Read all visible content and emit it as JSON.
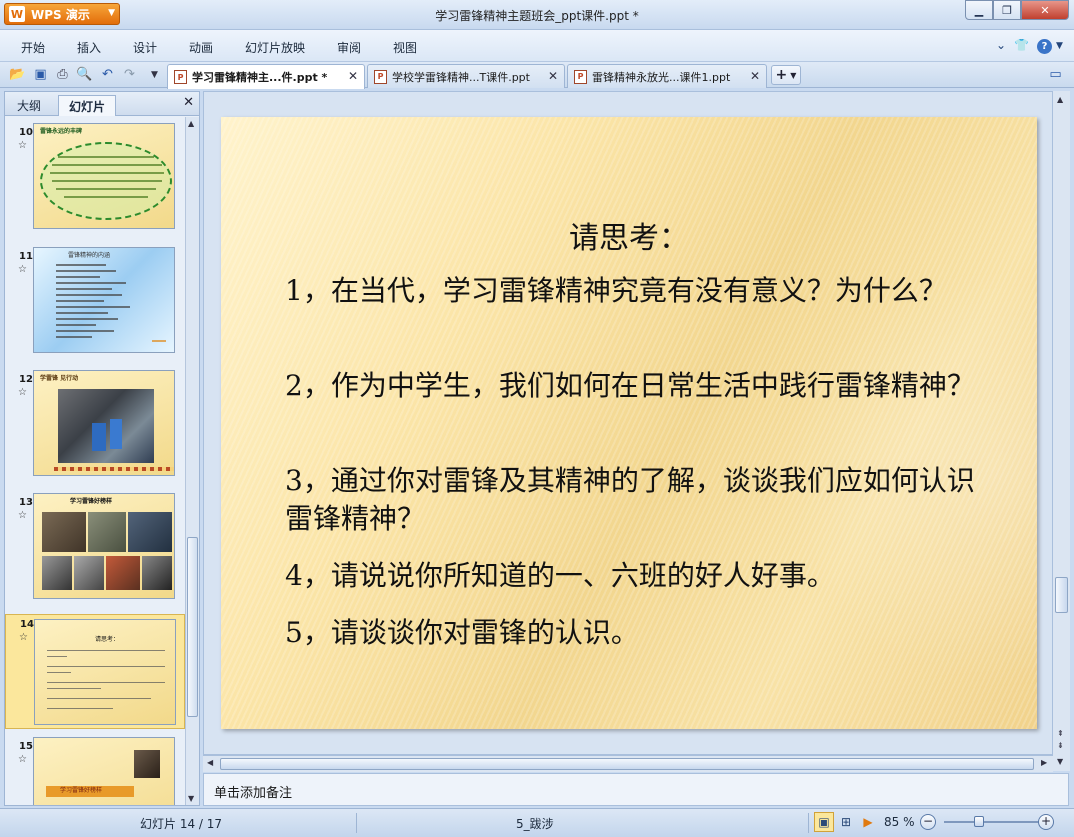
{
  "window": {
    "app_button": "WPS 演示",
    "title": "学习雷锋精神主题班会_ppt课件.ppt *",
    "minimize_icon": "minimize-icon",
    "maximize_icon": "maximize-icon",
    "close_icon": "close-icon"
  },
  "menu": {
    "items": [
      "开始",
      "插入",
      "设计",
      "动画",
      "幻灯片放映",
      "审阅",
      "视图"
    ]
  },
  "tabs": [
    {
      "label": "学习雷锋精神主...件.ppt *",
      "active": true
    },
    {
      "label": "学校学雷锋精神...T课件.ppt",
      "active": false
    },
    {
      "label": "雷锋精神永放光...课件1.ppt",
      "active": false
    }
  ],
  "toolbar": {
    "icons": [
      "open-icon",
      "save-icon",
      "print-icon",
      "print-preview-icon",
      "undo-icon",
      "redo-icon",
      "customize-icon"
    ],
    "new_tab": "+"
  },
  "left_panel": {
    "tabs": [
      "大纲",
      "幻灯片"
    ],
    "active_tab": "幻灯片",
    "slides": [
      {
        "number": "10",
        "title": "雷锋永远的丰碑"
      },
      {
        "number": "11",
        "title": "雷锋精神的内涵"
      },
      {
        "number": "12",
        "title": "学雷锋 见行动"
      },
      {
        "number": "13",
        "title": "学习雷锋好榜样"
      },
      {
        "number": "14",
        "title": "请思考："
      },
      {
        "number": "15",
        "title": "学习雷锋好榜样"
      }
    ],
    "selected_slide": "14"
  },
  "slide": {
    "title": "请思考：",
    "items": [
      "1，在当代，学习雷锋精神究竟有没有意义？为什么？",
      " 2，作为中学生，我们如何在日常生活中践行雷锋精神？",
      "3，通过你对雷锋及其精神的了解，谈谈我们应如何认识雷锋精神？",
      "4，请说说你所知道的一、六班的好人好事。",
      "5，请谈谈你对雷锋的认识。"
    ]
  },
  "notes": {
    "placeholder": "单击添加备注"
  },
  "status": {
    "slide_counter": "幻灯片 14 / 17",
    "theme": "5_跋涉",
    "zoom": "85 %",
    "zoom_value": 85
  },
  "colors": {
    "accent": "#e26d0a",
    "selection": "#fbe79c",
    "chrome": "#c9daf0"
  }
}
